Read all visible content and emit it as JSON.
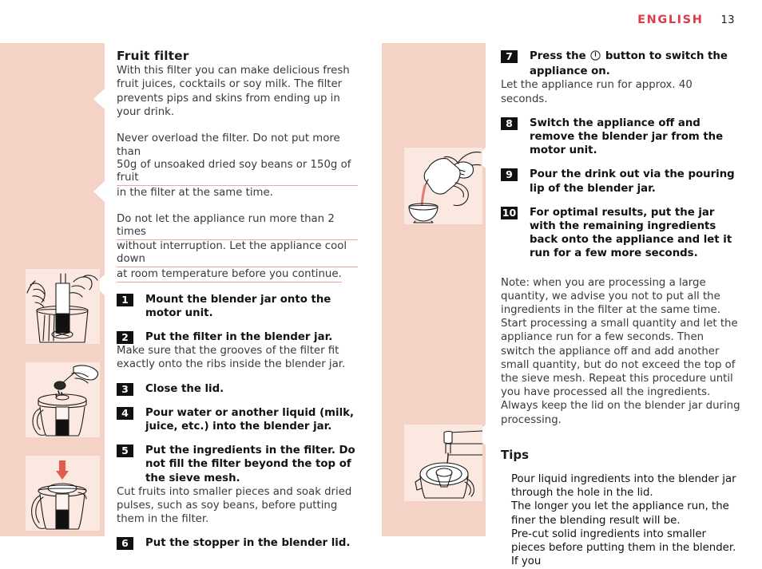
{
  "header": {
    "language": "ENGLISH",
    "page_number": "13",
    "accent_color": "#e03a44"
  },
  "colors": {
    "strip_background": "#f4d2c6",
    "illustration_background": "#fbe8e1",
    "underline": "#eda9a0",
    "step_box": "#111111",
    "arrow_red": "#e05a50"
  },
  "left_column": {
    "title": "Fruit filter",
    "intro": "With this filter you can make delicious fresh fruit juices, cocktails or soy milk. The filter prevents pips and skins from ending up in your drink.",
    "warning_1_line_1": "Never overload the filter. Do not put more than",
    "warning_1_line_2": "50g of unsoaked dried soy beans or 150g of fruit",
    "warning_1_line_3": "in the filter at the same time.",
    "warning_2_line_1": "Do not let the appliance run more than 2 times",
    "warning_2_line_2": "without interruption. Let the appliance cool down",
    "warning_2_line_3": "at room temperature before you continue.",
    "steps": [
      {
        "number": "1",
        "text": "Mount the blender jar onto the motor unit.",
        "sub": ""
      },
      {
        "number": "2",
        "text": "Put the filter in the blender jar.",
        "sub": "Make sure that the grooves of the filter fit exactly onto the ribs inside the blender jar."
      },
      {
        "number": "3",
        "text": "Close the lid.",
        "sub": ""
      },
      {
        "number": "4",
        "text": "Pour water or another liquid (milk, juice, etc.) into the blender jar.",
        "sub": ""
      },
      {
        "number": "5",
        "text": "Put the ingredients in the filter. Do not fill the filter beyond the top of the sieve mesh.",
        "sub": "Cut fruits into smaller pieces and soak dried pulses, such as soy beans, before putting them in the filter."
      },
      {
        "number": "6",
        "text": "Put the stopper in the blender lid.",
        "sub": ""
      }
    ]
  },
  "right_column": {
    "steps": [
      {
        "number": "7",
        "text_before_icon": "Press the",
        "icon": "power-button-icon",
        "text_after_icon": "button to switch the appliance on.",
        "sub": "Let the appliance run for approx. 40 seconds."
      },
      {
        "number": "8",
        "text": "Switch the appliance off and remove the blender jar from the motor unit.",
        "sub": ""
      },
      {
        "number": "9",
        "text": "Pour the drink out via the pouring lip of the blender jar.",
        "sub": ""
      },
      {
        "number": "10",
        "text": "For optimal results, put the jar with the remaining ingredients back onto the appliance and let it run for a few more seconds.",
        "sub": ""
      }
    ],
    "note": "Note: when you are processing a large quantity, we advise you not to put all the ingredients in the filter at the same time. Start processing a small quantity and let the appliance run for a few seconds. Then switch the appliance off and add another small quantity, but do not exceed the top of the sieve mesh. Repeat this procedure until you have processed all the ingredients. Always keep the lid on the blender jar during processing.",
    "tips_title": "Tips",
    "tips": [
      "Pour liquid ingredients into the blender jar through the hole in the lid.",
      "The longer you let the appliance run, the finer the blending result will be.",
      "Pre-cut solid ingredients into smaller pieces before putting them in the blender. If you"
    ]
  },
  "illustrations": {
    "left": [
      {
        "name": "filter-insert-into-jar-illustration",
        "caption_step": "2"
      },
      {
        "name": "pour-ingredients-into-filter-illustration",
        "caption_step": "5"
      },
      {
        "name": "stopper-into-lid-illustration",
        "caption_step": "6"
      }
    ],
    "middle": [
      {
        "name": "pour-drink-into-bowl-illustration",
        "caption_step": "9"
      },
      {
        "name": "pour-liquid-through-lid-hole-illustration",
        "caption_step": "tips"
      }
    ]
  }
}
